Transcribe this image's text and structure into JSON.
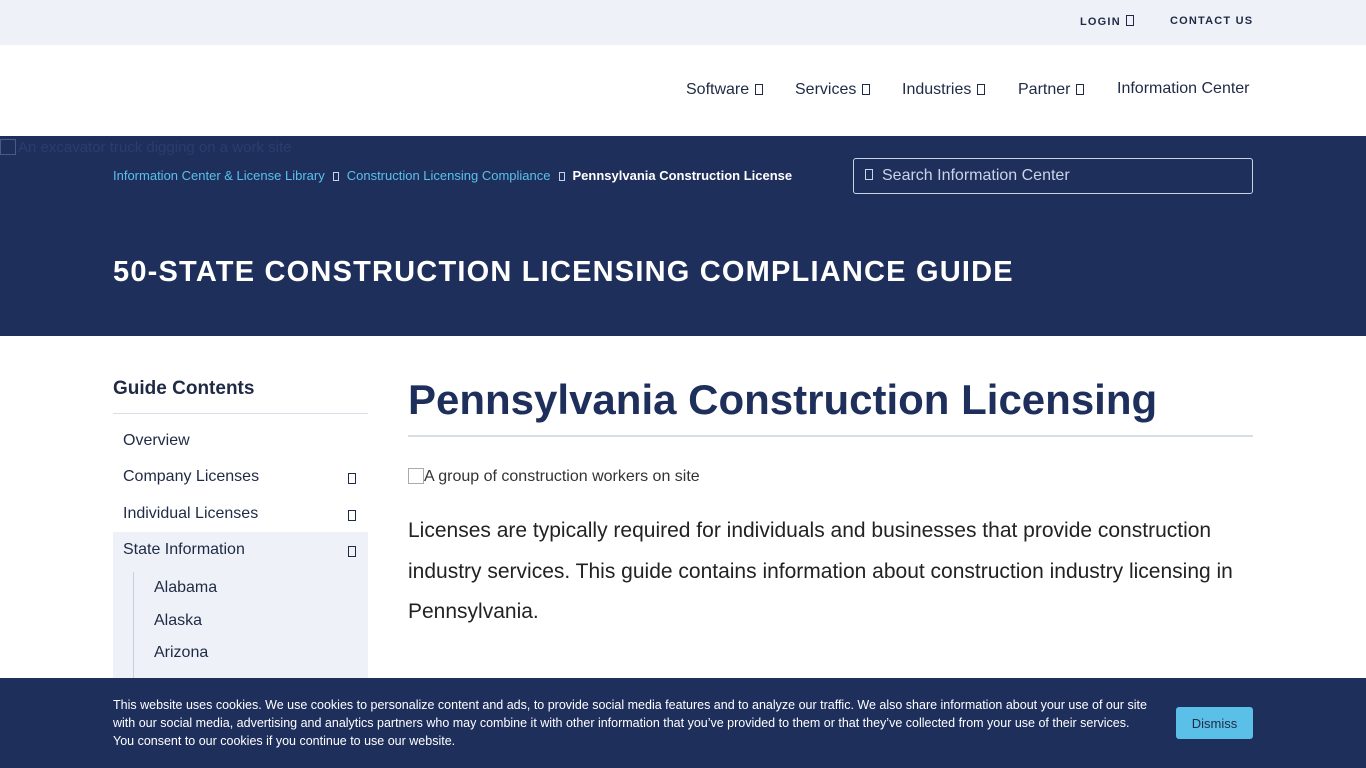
{
  "utility_bar": {
    "login": "LOGIN",
    "contact": "CONTACT US"
  },
  "nav": {
    "items": [
      {
        "label": "Software",
        "has_dropdown": true
      },
      {
        "label": "Services",
        "has_dropdown": true
      },
      {
        "label": "Industries",
        "has_dropdown": true
      },
      {
        "label": "Partner",
        "has_dropdown": true
      },
      {
        "label": "Information Center",
        "has_dropdown": false
      }
    ]
  },
  "hero": {
    "image_alt": "An excavator truck digging on a work site",
    "breadcrumb": [
      "Information Center & License Library",
      "Construction Licensing Compliance",
      "Pennsylvania Construction License"
    ],
    "search_placeholder": "Search Information Center",
    "title": "50-STATE CONSTRUCTION LICENSING COMPLIANCE GUIDE"
  },
  "sidebar": {
    "heading": "Guide Contents",
    "items": [
      {
        "label": "Overview"
      },
      {
        "label": "Company Licenses"
      },
      {
        "label": "Individual Licenses"
      },
      {
        "label": "State Information"
      }
    ],
    "sub_items": [
      "Alabama",
      "Alaska",
      "Arizona"
    ]
  },
  "content": {
    "title": "Pennsylvania Construction Licensing",
    "image_alt": "A group of construction workers on site",
    "intro": "Licenses are typically required for individuals and businesses that provide construction industry services. This guide contains information about construction industry licensing in Pennsylvania."
  },
  "cookie": {
    "text": "This website uses cookies. We use cookies to personalize content and ads, to provide social media features and to analyze our traffic. We also share information about your use of our site with our social media, advertising and analytics partners who may combine it with other information that you’ve provided to them or that they’ve collected from your use of their services. You consent to our cookies if you continue to use our website.",
    "dismiss": "Dismiss"
  },
  "colors": {
    "navy": "#1f2f5c",
    "accent": "#5bc0e8",
    "light_bg": "#eef2f8"
  }
}
